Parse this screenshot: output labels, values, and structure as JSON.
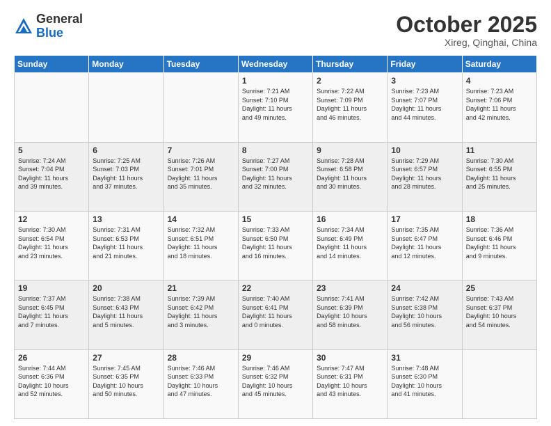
{
  "header": {
    "logo_general": "General",
    "logo_blue": "Blue",
    "month_title": "October 2025",
    "location": "Xireg, Qinghai, China"
  },
  "days_of_week": [
    "Sunday",
    "Monday",
    "Tuesday",
    "Wednesday",
    "Thursday",
    "Friday",
    "Saturday"
  ],
  "weeks": [
    [
      {
        "day": "",
        "info": ""
      },
      {
        "day": "",
        "info": ""
      },
      {
        "day": "",
        "info": ""
      },
      {
        "day": "1",
        "info": "Sunrise: 7:21 AM\nSunset: 7:10 PM\nDaylight: 11 hours\nand 49 minutes."
      },
      {
        "day": "2",
        "info": "Sunrise: 7:22 AM\nSunset: 7:09 PM\nDaylight: 11 hours\nand 46 minutes."
      },
      {
        "day": "3",
        "info": "Sunrise: 7:23 AM\nSunset: 7:07 PM\nDaylight: 11 hours\nand 44 minutes."
      },
      {
        "day": "4",
        "info": "Sunrise: 7:23 AM\nSunset: 7:06 PM\nDaylight: 11 hours\nand 42 minutes."
      }
    ],
    [
      {
        "day": "5",
        "info": "Sunrise: 7:24 AM\nSunset: 7:04 PM\nDaylight: 11 hours\nand 39 minutes."
      },
      {
        "day": "6",
        "info": "Sunrise: 7:25 AM\nSunset: 7:03 PM\nDaylight: 11 hours\nand 37 minutes."
      },
      {
        "day": "7",
        "info": "Sunrise: 7:26 AM\nSunset: 7:01 PM\nDaylight: 11 hours\nand 35 minutes."
      },
      {
        "day": "8",
        "info": "Sunrise: 7:27 AM\nSunset: 7:00 PM\nDaylight: 11 hours\nand 32 minutes."
      },
      {
        "day": "9",
        "info": "Sunrise: 7:28 AM\nSunset: 6:58 PM\nDaylight: 11 hours\nand 30 minutes."
      },
      {
        "day": "10",
        "info": "Sunrise: 7:29 AM\nSunset: 6:57 PM\nDaylight: 11 hours\nand 28 minutes."
      },
      {
        "day": "11",
        "info": "Sunrise: 7:30 AM\nSunset: 6:55 PM\nDaylight: 11 hours\nand 25 minutes."
      }
    ],
    [
      {
        "day": "12",
        "info": "Sunrise: 7:30 AM\nSunset: 6:54 PM\nDaylight: 11 hours\nand 23 minutes."
      },
      {
        "day": "13",
        "info": "Sunrise: 7:31 AM\nSunset: 6:53 PM\nDaylight: 11 hours\nand 21 minutes."
      },
      {
        "day": "14",
        "info": "Sunrise: 7:32 AM\nSunset: 6:51 PM\nDaylight: 11 hours\nand 18 minutes."
      },
      {
        "day": "15",
        "info": "Sunrise: 7:33 AM\nSunset: 6:50 PM\nDaylight: 11 hours\nand 16 minutes."
      },
      {
        "day": "16",
        "info": "Sunrise: 7:34 AM\nSunset: 6:49 PM\nDaylight: 11 hours\nand 14 minutes."
      },
      {
        "day": "17",
        "info": "Sunrise: 7:35 AM\nSunset: 6:47 PM\nDaylight: 11 hours\nand 12 minutes."
      },
      {
        "day": "18",
        "info": "Sunrise: 7:36 AM\nSunset: 6:46 PM\nDaylight: 11 hours\nand 9 minutes."
      }
    ],
    [
      {
        "day": "19",
        "info": "Sunrise: 7:37 AM\nSunset: 6:45 PM\nDaylight: 11 hours\nand 7 minutes."
      },
      {
        "day": "20",
        "info": "Sunrise: 7:38 AM\nSunset: 6:43 PM\nDaylight: 11 hours\nand 5 minutes."
      },
      {
        "day": "21",
        "info": "Sunrise: 7:39 AM\nSunset: 6:42 PM\nDaylight: 11 hours\nand 3 minutes."
      },
      {
        "day": "22",
        "info": "Sunrise: 7:40 AM\nSunset: 6:41 PM\nDaylight: 11 hours\nand 0 minutes."
      },
      {
        "day": "23",
        "info": "Sunrise: 7:41 AM\nSunset: 6:39 PM\nDaylight: 10 hours\nand 58 minutes."
      },
      {
        "day": "24",
        "info": "Sunrise: 7:42 AM\nSunset: 6:38 PM\nDaylight: 10 hours\nand 56 minutes."
      },
      {
        "day": "25",
        "info": "Sunrise: 7:43 AM\nSunset: 6:37 PM\nDaylight: 10 hours\nand 54 minutes."
      }
    ],
    [
      {
        "day": "26",
        "info": "Sunrise: 7:44 AM\nSunset: 6:36 PM\nDaylight: 10 hours\nand 52 minutes."
      },
      {
        "day": "27",
        "info": "Sunrise: 7:45 AM\nSunset: 6:35 PM\nDaylight: 10 hours\nand 50 minutes."
      },
      {
        "day": "28",
        "info": "Sunrise: 7:46 AM\nSunset: 6:33 PM\nDaylight: 10 hours\nand 47 minutes."
      },
      {
        "day": "29",
        "info": "Sunrise: 7:46 AM\nSunset: 6:32 PM\nDaylight: 10 hours\nand 45 minutes."
      },
      {
        "day": "30",
        "info": "Sunrise: 7:47 AM\nSunset: 6:31 PM\nDaylight: 10 hours\nand 43 minutes."
      },
      {
        "day": "31",
        "info": "Sunrise: 7:48 AM\nSunset: 6:30 PM\nDaylight: 10 hours\nand 41 minutes."
      },
      {
        "day": "",
        "info": ""
      }
    ]
  ]
}
